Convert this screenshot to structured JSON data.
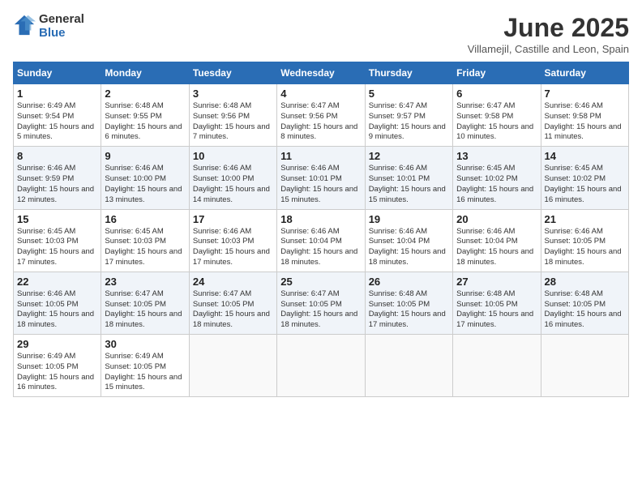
{
  "header": {
    "logo_line1": "General",
    "logo_line2": "Blue",
    "month_title": "June 2025",
    "subtitle": "Villamejil, Castille and Leon, Spain"
  },
  "days_of_week": [
    "Sunday",
    "Monday",
    "Tuesday",
    "Wednesday",
    "Thursday",
    "Friday",
    "Saturday"
  ],
  "weeks": [
    [
      {
        "day": 1,
        "sunrise": "6:49 AM",
        "sunset": "9:54 PM",
        "daylight": "Daylight: 15 hours and 5 minutes."
      },
      {
        "day": 2,
        "sunrise": "6:48 AM",
        "sunset": "9:55 PM",
        "daylight": "Daylight: 15 hours and 6 minutes."
      },
      {
        "day": 3,
        "sunrise": "6:48 AM",
        "sunset": "9:56 PM",
        "daylight": "Daylight: 15 hours and 7 minutes."
      },
      {
        "day": 4,
        "sunrise": "6:47 AM",
        "sunset": "9:56 PM",
        "daylight": "Daylight: 15 hours and 8 minutes."
      },
      {
        "day": 5,
        "sunrise": "6:47 AM",
        "sunset": "9:57 PM",
        "daylight": "Daylight: 15 hours and 9 minutes."
      },
      {
        "day": 6,
        "sunrise": "6:47 AM",
        "sunset": "9:58 PM",
        "daylight": "Daylight: 15 hours and 10 minutes."
      },
      {
        "day": 7,
        "sunrise": "6:46 AM",
        "sunset": "9:58 PM",
        "daylight": "Daylight: 15 hours and 11 minutes."
      }
    ],
    [
      {
        "day": 8,
        "sunrise": "6:46 AM",
        "sunset": "9:59 PM",
        "daylight": "Daylight: 15 hours and 12 minutes."
      },
      {
        "day": 9,
        "sunrise": "6:46 AM",
        "sunset": "10:00 PM",
        "daylight": "Daylight: 15 hours and 13 minutes."
      },
      {
        "day": 10,
        "sunrise": "6:46 AM",
        "sunset": "10:00 PM",
        "daylight": "Daylight: 15 hours and 14 minutes."
      },
      {
        "day": 11,
        "sunrise": "6:46 AM",
        "sunset": "10:01 PM",
        "daylight": "Daylight: 15 hours and 15 minutes."
      },
      {
        "day": 12,
        "sunrise": "6:46 AM",
        "sunset": "10:01 PM",
        "daylight": "Daylight: 15 hours and 15 minutes."
      },
      {
        "day": 13,
        "sunrise": "6:45 AM",
        "sunset": "10:02 PM",
        "daylight": "Daylight: 15 hours and 16 minutes."
      },
      {
        "day": 14,
        "sunrise": "6:45 AM",
        "sunset": "10:02 PM",
        "daylight": "Daylight: 15 hours and 16 minutes."
      }
    ],
    [
      {
        "day": 15,
        "sunrise": "6:45 AM",
        "sunset": "10:03 PM",
        "daylight": "Daylight: 15 hours and 17 minutes."
      },
      {
        "day": 16,
        "sunrise": "6:45 AM",
        "sunset": "10:03 PM",
        "daylight": "Daylight: 15 hours and 17 minutes."
      },
      {
        "day": 17,
        "sunrise": "6:46 AM",
        "sunset": "10:03 PM",
        "daylight": "Daylight: 15 hours and 17 minutes."
      },
      {
        "day": 18,
        "sunrise": "6:46 AM",
        "sunset": "10:04 PM",
        "daylight": "Daylight: 15 hours and 18 minutes."
      },
      {
        "day": 19,
        "sunrise": "6:46 AM",
        "sunset": "10:04 PM",
        "daylight": "Daylight: 15 hours and 18 minutes."
      },
      {
        "day": 20,
        "sunrise": "6:46 AM",
        "sunset": "10:04 PM",
        "daylight": "Daylight: 15 hours and 18 minutes."
      },
      {
        "day": 21,
        "sunrise": "6:46 AM",
        "sunset": "10:05 PM",
        "daylight": "Daylight: 15 hours and 18 minutes."
      }
    ],
    [
      {
        "day": 22,
        "sunrise": "6:46 AM",
        "sunset": "10:05 PM",
        "daylight": "Daylight: 15 hours and 18 minutes."
      },
      {
        "day": 23,
        "sunrise": "6:47 AM",
        "sunset": "10:05 PM",
        "daylight": "Daylight: 15 hours and 18 minutes."
      },
      {
        "day": 24,
        "sunrise": "6:47 AM",
        "sunset": "10:05 PM",
        "daylight": "Daylight: 15 hours and 18 minutes."
      },
      {
        "day": 25,
        "sunrise": "6:47 AM",
        "sunset": "10:05 PM",
        "daylight": "Daylight: 15 hours and 18 minutes."
      },
      {
        "day": 26,
        "sunrise": "6:48 AM",
        "sunset": "10:05 PM",
        "daylight": "Daylight: 15 hours and 17 minutes."
      },
      {
        "day": 27,
        "sunrise": "6:48 AM",
        "sunset": "10:05 PM",
        "daylight": "Daylight: 15 hours and 17 minutes."
      },
      {
        "day": 28,
        "sunrise": "6:48 AM",
        "sunset": "10:05 PM",
        "daylight": "Daylight: 15 hours and 16 minutes."
      }
    ],
    [
      {
        "day": 29,
        "sunrise": "6:49 AM",
        "sunset": "10:05 PM",
        "daylight": "Daylight: 15 hours and 16 minutes."
      },
      {
        "day": 30,
        "sunrise": "6:49 AM",
        "sunset": "10:05 PM",
        "daylight": "Daylight: 15 hours and 15 minutes."
      },
      null,
      null,
      null,
      null,
      null
    ]
  ]
}
